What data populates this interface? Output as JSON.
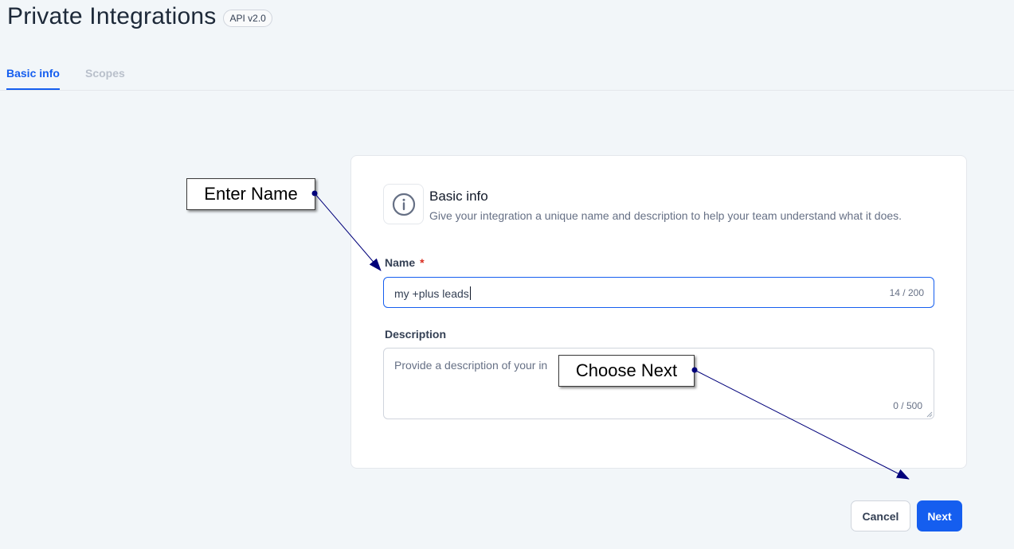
{
  "header": {
    "title": "Private Integrations",
    "badge": "API v2.0"
  },
  "tabs": [
    {
      "label": "Basic info",
      "active": true
    },
    {
      "label": "Scopes",
      "active": false
    }
  ],
  "card": {
    "icon": "info-icon",
    "title": "Basic info",
    "subtitle": "Give your integration a unique name and description to help your team understand what it does.",
    "name_field": {
      "label": "Name",
      "required_mark": "*",
      "value": "my +plus leads",
      "counter": "14 / 200"
    },
    "description_field": {
      "label": "Description",
      "placeholder": "Provide a description of your in",
      "counter": "0 / 500"
    }
  },
  "actions": {
    "cancel_label": "Cancel",
    "next_label": "Next"
  },
  "annotations": {
    "enter_name": "Enter Name",
    "choose_next": "Choose Next"
  },
  "colors": {
    "accent": "#155eef",
    "background": "#f2f6f9",
    "annotation_arrow": "#00007a"
  }
}
